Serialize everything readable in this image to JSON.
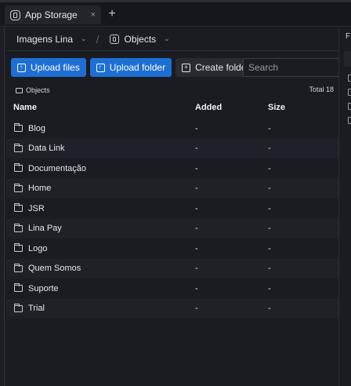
{
  "tab": {
    "title": "App Storage",
    "close": "×",
    "new": "+"
  },
  "crumbs": {
    "bucket": "Imagens Lina",
    "folder": "Objects"
  },
  "toolbar": {
    "upload_files": "Upload files",
    "upload_folder": "Upload folder",
    "create_folder": "Create folder",
    "search_placeholder": "Search"
  },
  "path": {
    "label": "Objects",
    "total": "Total 18"
  },
  "table": {
    "headers": {
      "name": "Name",
      "added": "Added",
      "size": "Size"
    },
    "rows": [
      {
        "name": "Blog",
        "added": "-",
        "size": "-"
      },
      {
        "name": "Data Link",
        "added": "-",
        "size": "-"
      },
      {
        "name": "Documentação",
        "added": "-",
        "size": "-"
      },
      {
        "name": "Home",
        "added": "-",
        "size": "-"
      },
      {
        "name": "JSR",
        "added": "-",
        "size": "-"
      },
      {
        "name": "Lina Pay",
        "added": "-",
        "size": "-"
      },
      {
        "name": "Logo",
        "added": "-",
        "size": "-"
      },
      {
        "name": "Quem Somos",
        "added": "-",
        "size": "-"
      },
      {
        "name": "Suporte",
        "added": "-",
        "size": "-"
      },
      {
        "name": "Trial",
        "added": "-",
        "size": "-"
      }
    ]
  },
  "right_panel": {
    "header": "F"
  },
  "colors": {
    "accent": "#1d6fd4",
    "background": "#1b1c22"
  }
}
